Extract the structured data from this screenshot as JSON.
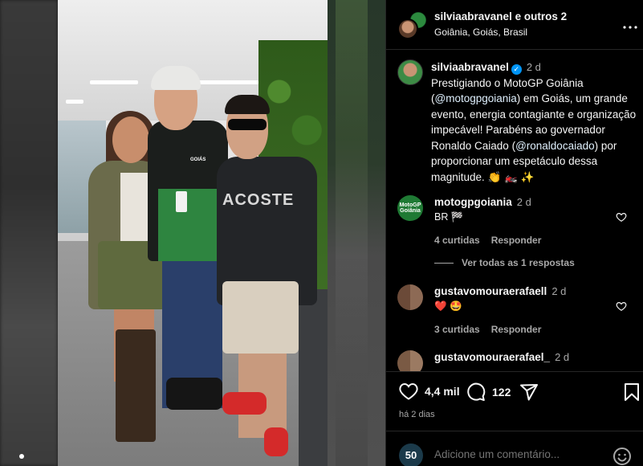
{
  "header": {
    "username": "silviaabravanel",
    "others": "e outros 2",
    "location": "Goiânia, Goiás, Brasil",
    "more_icon": "more-icon"
  },
  "caption": {
    "username": "silviaabravanel",
    "time": "2 d",
    "text_parts": [
      "Prestigiando o MotoGP Goiânia (",
      "@motogpgoiania",
      ") em Goiás, um grande evento, energia contagiante e organização impecável! Parabéns ao governador Ronaldo Caiado (",
      "@ronaldocaiado",
      ") por proporcionar um espetáculo dessa magnitude. 👏 🏍️ ✨"
    ]
  },
  "comments": [
    {
      "username": "motogpgoiania",
      "time": "2 d",
      "text": "BR 🏁",
      "likes": "4 curtidas",
      "reply": "Responder",
      "avatar_label": "MotoGP Goiânia"
    },
    {
      "username": "gustavomouraerafaell",
      "time": "2 d",
      "text": "❤️ 🤩",
      "likes": "3 curtidas",
      "reply": "Responder"
    },
    {
      "username": "gustavomouraerafael_",
      "time": "2 d",
      "text": "",
      "likes": "",
      "reply": ""
    }
  ],
  "view_replies": "Ver todas as 1 respostas",
  "photo": {
    "shirt_text": "ACOSTE",
    "logo_text": "GOIÁS"
  },
  "actions": {
    "likes": "4,4 mil",
    "comments": "122"
  },
  "posted": "há 2 dias",
  "add_comment": {
    "placeholder": "Adicione um comentário...",
    "avatar_text": "50"
  },
  "colors": {
    "background": "#000000",
    "link": "#e0f1ff",
    "muted": "#a8a8a8",
    "verified": "#0095f6",
    "heart": "#ff3040"
  }
}
